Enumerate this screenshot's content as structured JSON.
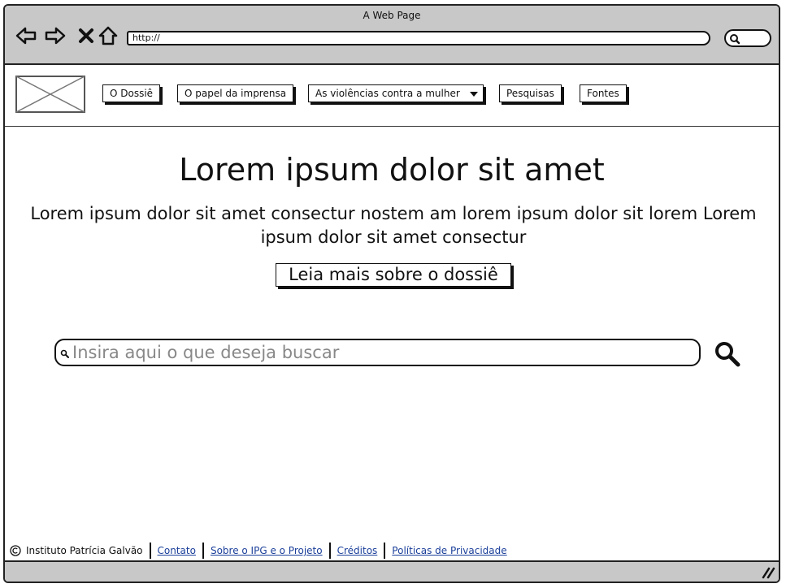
{
  "browser": {
    "title": "A Web Page",
    "url": "http://"
  },
  "nav": {
    "items": [
      {
        "label": "O Dossiê"
      },
      {
        "label": "O papel da imprensa"
      },
      {
        "label": "As violências contra a mulher",
        "has_dropdown": true
      },
      {
        "label": "Pesquisas"
      },
      {
        "label": "Fontes"
      }
    ]
  },
  "hero": {
    "title": "Lorem ipsum dolor sit amet",
    "text": "Lorem ipsum dolor sit amet consectur nostem am lorem ipsum dolor sit lorem Lorem ipsum dolor sit amet consectur",
    "button_label": "Leia mais sobre o dossiê"
  },
  "search": {
    "placeholder": "Insira aqui o que deseja buscar",
    "value": ""
  },
  "footer": {
    "copyright": "Instituto Patrícia Galvão",
    "links": [
      {
        "label": "Contato"
      },
      {
        "label": "Sobre o IPG e o Projeto"
      },
      {
        "label": "Créditos"
      },
      {
        "label": "Políticas de Privacidade"
      }
    ]
  },
  "colors": {
    "chrome": "#c8c8c8",
    "link": "#1b3f9a",
    "ink": "#111111"
  }
}
